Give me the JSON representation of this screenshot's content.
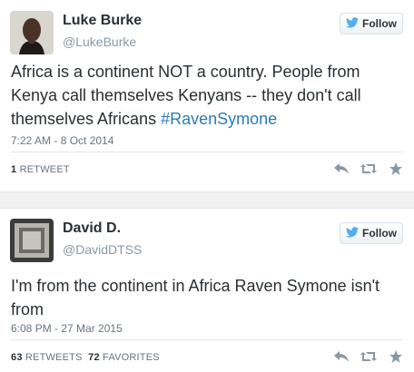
{
  "colors": {
    "link": "#2b7bb9",
    "muted": "#8899a6",
    "text": "#292f33"
  },
  "tweets": [
    {
      "name": "Luke Burke",
      "handle": "@LukeBurke",
      "follow_label": "Follow",
      "text_plain": "Africa is a continent NOT a country. People from Kenya call themselves Kenyans -- they don't call themselves Africans ",
      "hashtag": "#RavenSymone",
      "date": "7:22 AM - 8 Oct 2014",
      "retweets_count": "1",
      "retweets_label": "RETWEET",
      "favorites_count": "",
      "favorites_label": "",
      "icons": [
        "reply-icon",
        "retweet-icon",
        "favorite-star-icon"
      ]
    },
    {
      "name": "David D.",
      "handle": "@DavidDTSS",
      "follow_label": "Follow",
      "text_plain": "I'm from the continent in Africa Raven Symone isn't from",
      "hashtag": "",
      "date": "6:08 PM - 27 Mar 2015",
      "retweets_count": "63",
      "retweets_label": "RETWEETS",
      "favorites_count": "72",
      "favorites_label": "FAVORITES",
      "icons": [
        "reply-icon",
        "retweet-icon",
        "favorite-star-icon"
      ]
    }
  ]
}
